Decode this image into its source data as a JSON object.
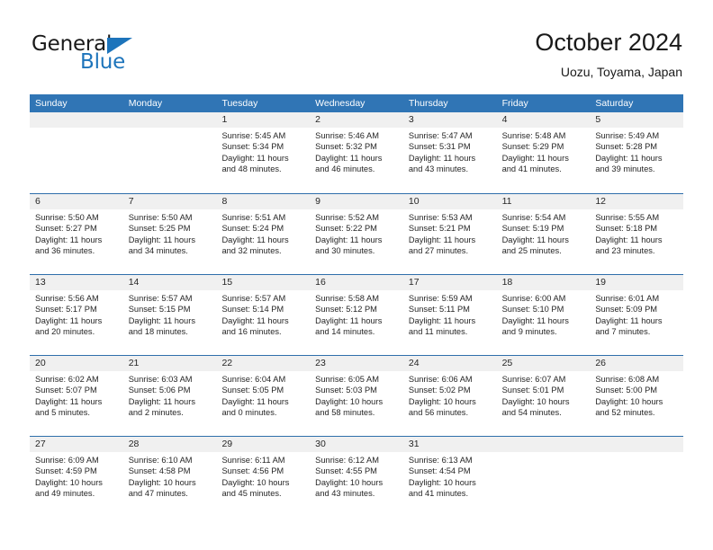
{
  "logo": {
    "word_top": "General",
    "word_bottom": "Blue",
    "triangle_icon": "triangle-icon"
  },
  "header": {
    "title": "October 2024",
    "subtitle": "Uozu, Toyama, Japan"
  },
  "colors": {
    "header_blue": "#3075b5",
    "row_divider": "#2f6fab",
    "day_head_gray": "#f0f0f0",
    "logo_blue": "#1d74bb",
    "text": "#262626"
  },
  "calendar": {
    "weekday_headers": [
      "Sunday",
      "Monday",
      "Tuesday",
      "Wednesday",
      "Thursday",
      "Friday",
      "Saturday"
    ],
    "weeks": [
      [
        {
          "date": "",
          "lines": []
        },
        {
          "date": "",
          "lines": []
        },
        {
          "date": "1",
          "lines": [
            "Sunrise: 5:45 AM",
            "Sunset: 5:34 PM",
            "Daylight: 11 hours",
            "and 48 minutes."
          ]
        },
        {
          "date": "2",
          "lines": [
            "Sunrise: 5:46 AM",
            "Sunset: 5:32 PM",
            "Daylight: 11 hours",
            "and 46 minutes."
          ]
        },
        {
          "date": "3",
          "lines": [
            "Sunrise: 5:47 AM",
            "Sunset: 5:31 PM",
            "Daylight: 11 hours",
            "and 43 minutes."
          ]
        },
        {
          "date": "4",
          "lines": [
            "Sunrise: 5:48 AM",
            "Sunset: 5:29 PM",
            "Daylight: 11 hours",
            "and 41 minutes."
          ]
        },
        {
          "date": "5",
          "lines": [
            "Sunrise: 5:49 AM",
            "Sunset: 5:28 PM",
            "Daylight: 11 hours",
            "and 39 minutes."
          ]
        }
      ],
      [
        {
          "date": "6",
          "lines": [
            "Sunrise: 5:50 AM",
            "Sunset: 5:27 PM",
            "Daylight: 11 hours",
            "and 36 minutes."
          ]
        },
        {
          "date": "7",
          "lines": [
            "Sunrise: 5:50 AM",
            "Sunset: 5:25 PM",
            "Daylight: 11 hours",
            "and 34 minutes."
          ]
        },
        {
          "date": "8",
          "lines": [
            "Sunrise: 5:51 AM",
            "Sunset: 5:24 PM",
            "Daylight: 11 hours",
            "and 32 minutes."
          ]
        },
        {
          "date": "9",
          "lines": [
            "Sunrise: 5:52 AM",
            "Sunset: 5:22 PM",
            "Daylight: 11 hours",
            "and 30 minutes."
          ]
        },
        {
          "date": "10",
          "lines": [
            "Sunrise: 5:53 AM",
            "Sunset: 5:21 PM",
            "Daylight: 11 hours",
            "and 27 minutes."
          ]
        },
        {
          "date": "11",
          "lines": [
            "Sunrise: 5:54 AM",
            "Sunset: 5:19 PM",
            "Daylight: 11 hours",
            "and 25 minutes."
          ]
        },
        {
          "date": "12",
          "lines": [
            "Sunrise: 5:55 AM",
            "Sunset: 5:18 PM",
            "Daylight: 11 hours",
            "and 23 minutes."
          ]
        }
      ],
      [
        {
          "date": "13",
          "lines": [
            "Sunrise: 5:56 AM",
            "Sunset: 5:17 PM",
            "Daylight: 11 hours",
            "and 20 minutes."
          ]
        },
        {
          "date": "14",
          "lines": [
            "Sunrise: 5:57 AM",
            "Sunset: 5:15 PM",
            "Daylight: 11 hours",
            "and 18 minutes."
          ]
        },
        {
          "date": "15",
          "lines": [
            "Sunrise: 5:57 AM",
            "Sunset: 5:14 PM",
            "Daylight: 11 hours",
            "and 16 minutes."
          ]
        },
        {
          "date": "16",
          "lines": [
            "Sunrise: 5:58 AM",
            "Sunset: 5:12 PM",
            "Daylight: 11 hours",
            "and 14 minutes."
          ]
        },
        {
          "date": "17",
          "lines": [
            "Sunrise: 5:59 AM",
            "Sunset: 5:11 PM",
            "Daylight: 11 hours",
            "and 11 minutes."
          ]
        },
        {
          "date": "18",
          "lines": [
            "Sunrise: 6:00 AM",
            "Sunset: 5:10 PM",
            "Daylight: 11 hours",
            "and 9 minutes."
          ]
        },
        {
          "date": "19",
          "lines": [
            "Sunrise: 6:01 AM",
            "Sunset: 5:09 PM",
            "Daylight: 11 hours",
            "and 7 minutes."
          ]
        }
      ],
      [
        {
          "date": "20",
          "lines": [
            "Sunrise: 6:02 AM",
            "Sunset: 5:07 PM",
            "Daylight: 11 hours",
            "and 5 minutes."
          ]
        },
        {
          "date": "21",
          "lines": [
            "Sunrise: 6:03 AM",
            "Sunset: 5:06 PM",
            "Daylight: 11 hours",
            "and 2 minutes."
          ]
        },
        {
          "date": "22",
          "lines": [
            "Sunrise: 6:04 AM",
            "Sunset: 5:05 PM",
            "Daylight: 11 hours",
            "and 0 minutes."
          ]
        },
        {
          "date": "23",
          "lines": [
            "Sunrise: 6:05 AM",
            "Sunset: 5:03 PM",
            "Daylight: 10 hours",
            "and 58 minutes."
          ]
        },
        {
          "date": "24",
          "lines": [
            "Sunrise: 6:06 AM",
            "Sunset: 5:02 PM",
            "Daylight: 10 hours",
            "and 56 minutes."
          ]
        },
        {
          "date": "25",
          "lines": [
            "Sunrise: 6:07 AM",
            "Sunset: 5:01 PM",
            "Daylight: 10 hours",
            "and 54 minutes."
          ]
        },
        {
          "date": "26",
          "lines": [
            "Sunrise: 6:08 AM",
            "Sunset: 5:00 PM",
            "Daylight: 10 hours",
            "and 52 minutes."
          ]
        }
      ],
      [
        {
          "date": "27",
          "lines": [
            "Sunrise: 6:09 AM",
            "Sunset: 4:59 PM",
            "Daylight: 10 hours",
            "and 49 minutes."
          ]
        },
        {
          "date": "28",
          "lines": [
            "Sunrise: 6:10 AM",
            "Sunset: 4:58 PM",
            "Daylight: 10 hours",
            "and 47 minutes."
          ]
        },
        {
          "date": "29",
          "lines": [
            "Sunrise: 6:11 AM",
            "Sunset: 4:56 PM",
            "Daylight: 10 hours",
            "and 45 minutes."
          ]
        },
        {
          "date": "30",
          "lines": [
            "Sunrise: 6:12 AM",
            "Sunset: 4:55 PM",
            "Daylight: 10 hours",
            "and 43 minutes."
          ]
        },
        {
          "date": "31",
          "lines": [
            "Sunrise: 6:13 AM",
            "Sunset: 4:54 PM",
            "Daylight: 10 hours",
            "and 41 minutes."
          ]
        },
        {
          "date": "",
          "lines": []
        },
        {
          "date": "",
          "lines": []
        }
      ]
    ]
  }
}
